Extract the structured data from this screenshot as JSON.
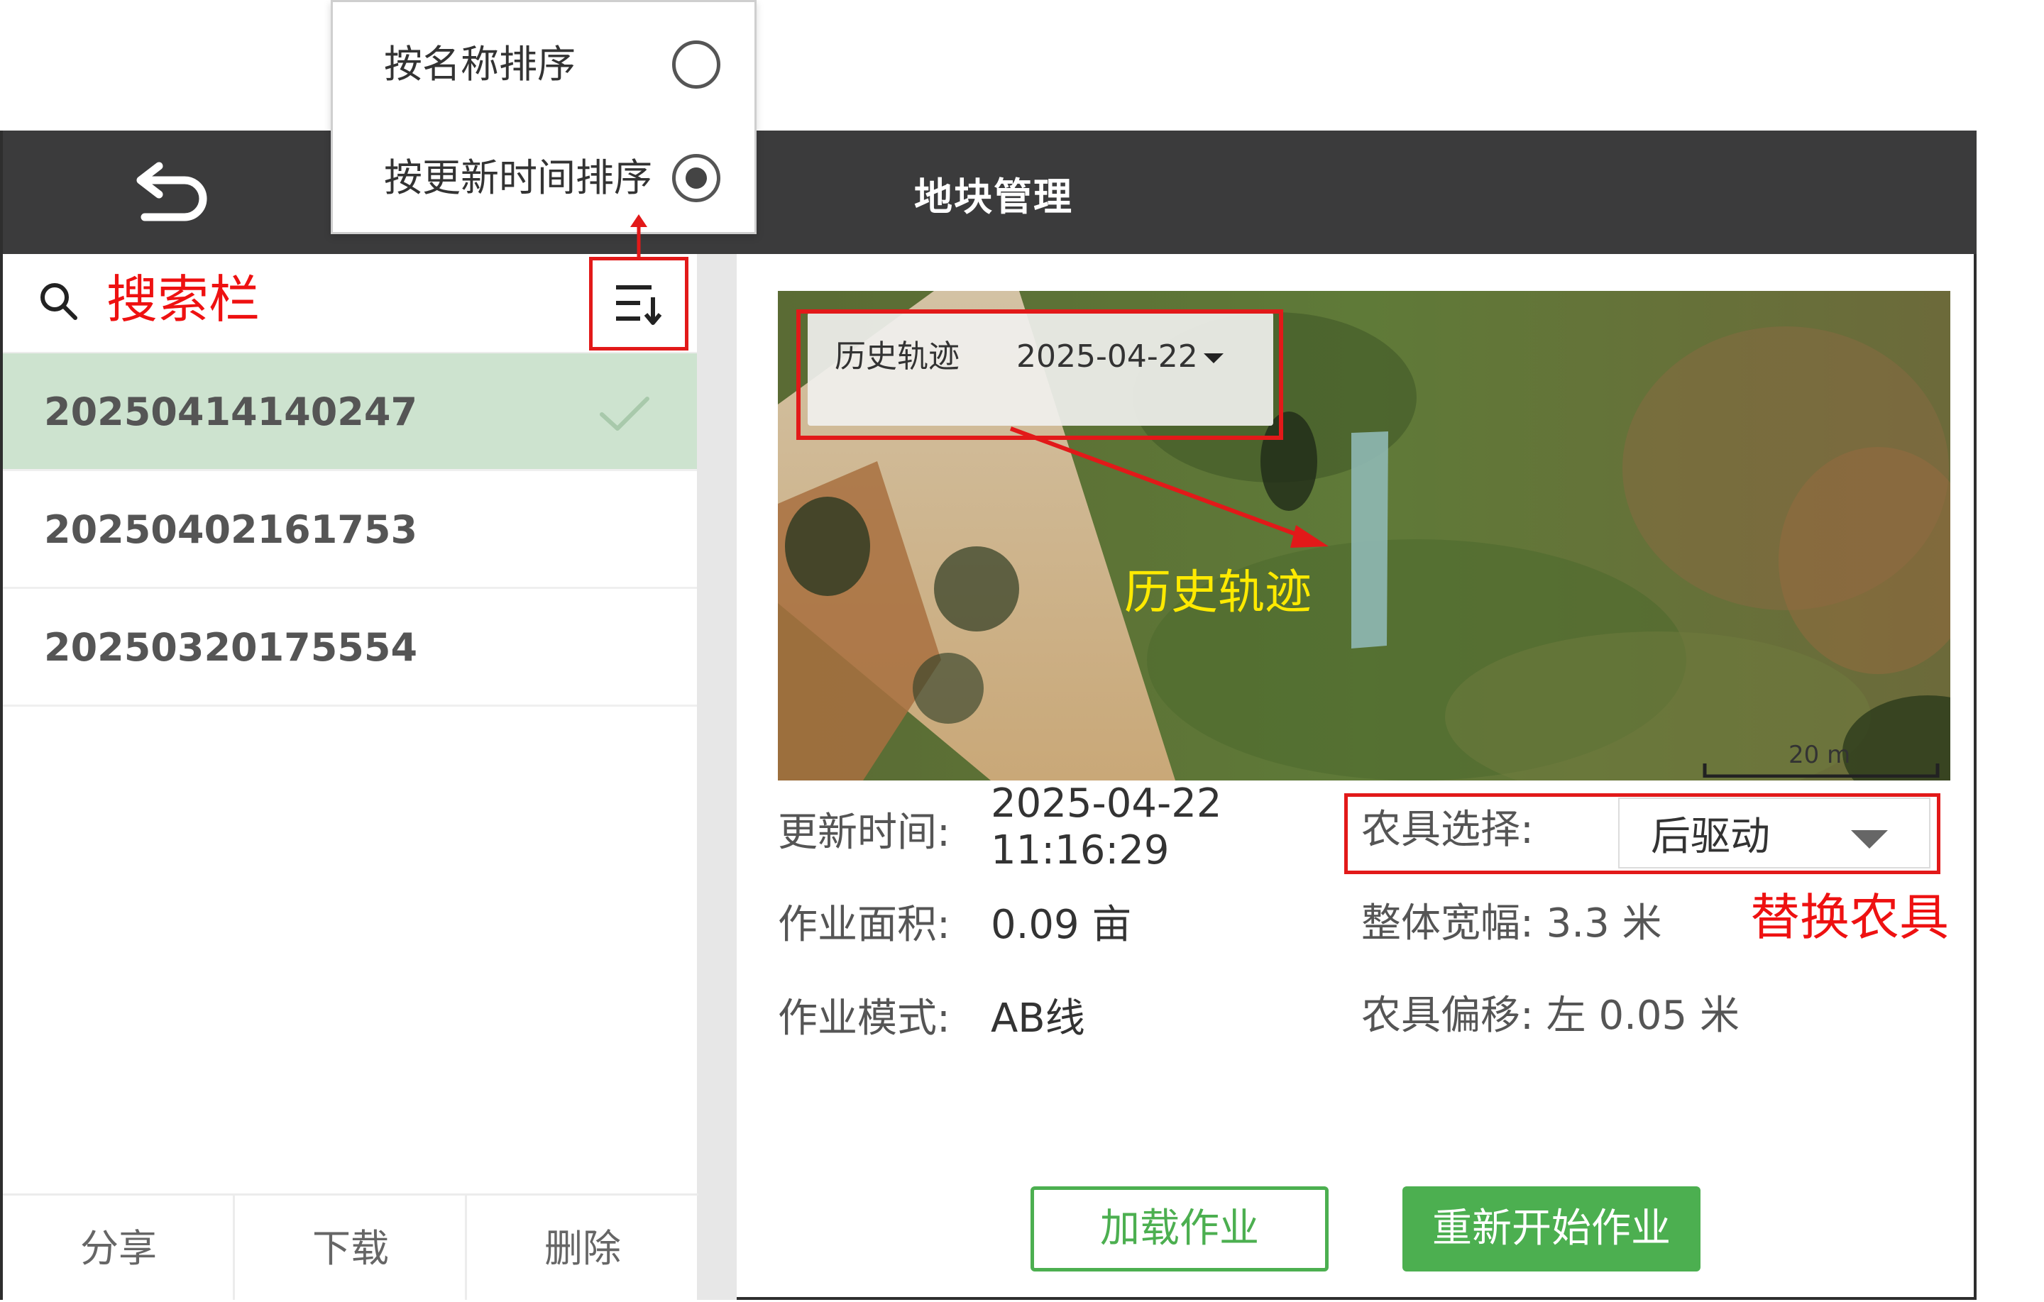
{
  "header": {
    "title": "地块管理",
    "back_icon": "undo-arrow-icon"
  },
  "search": {
    "annotation": "搜索栏",
    "icon": "search-icon"
  },
  "sort_menu": {
    "options": [
      {
        "label": "按名称排序",
        "selected": false
      },
      {
        "label": "按更新时间排序",
        "selected": true
      }
    ]
  },
  "field_list": {
    "items": [
      {
        "name": "20250414140247",
        "selected": true
      },
      {
        "name": "20250402161753",
        "selected": false
      },
      {
        "name": "20250320175554",
        "selected": false
      }
    ]
  },
  "footer": {
    "share": "分享",
    "download": "下载",
    "delete": "删除"
  },
  "map": {
    "history_label": "历史轨迹",
    "history_date": "2025-04-22",
    "history_callout": "历史轨迹",
    "scale": "20 m"
  },
  "details": {
    "update_time_label": "更新时间:",
    "update_date": "2025-04-22",
    "update_time": "11:16:29",
    "area_label": "作业面积:",
    "area_value": "0.09 亩",
    "mode_label": "作业模式:",
    "mode_value": "AB线",
    "implement_label": "农具选择:",
    "implement_value": "后驱动",
    "implement_callout": "替换农具",
    "width_label": "整体宽幅: 3.3 米",
    "offset_label": "农具偏移: 左 0.05 米"
  },
  "actions": {
    "load": "加载作业",
    "restart": "重新开始作业"
  },
  "colors": {
    "accent_green": "#4caf50",
    "annotation_red": "#e21919",
    "topbar": "#3b3b3c",
    "selected_row": "#cde3cf"
  }
}
